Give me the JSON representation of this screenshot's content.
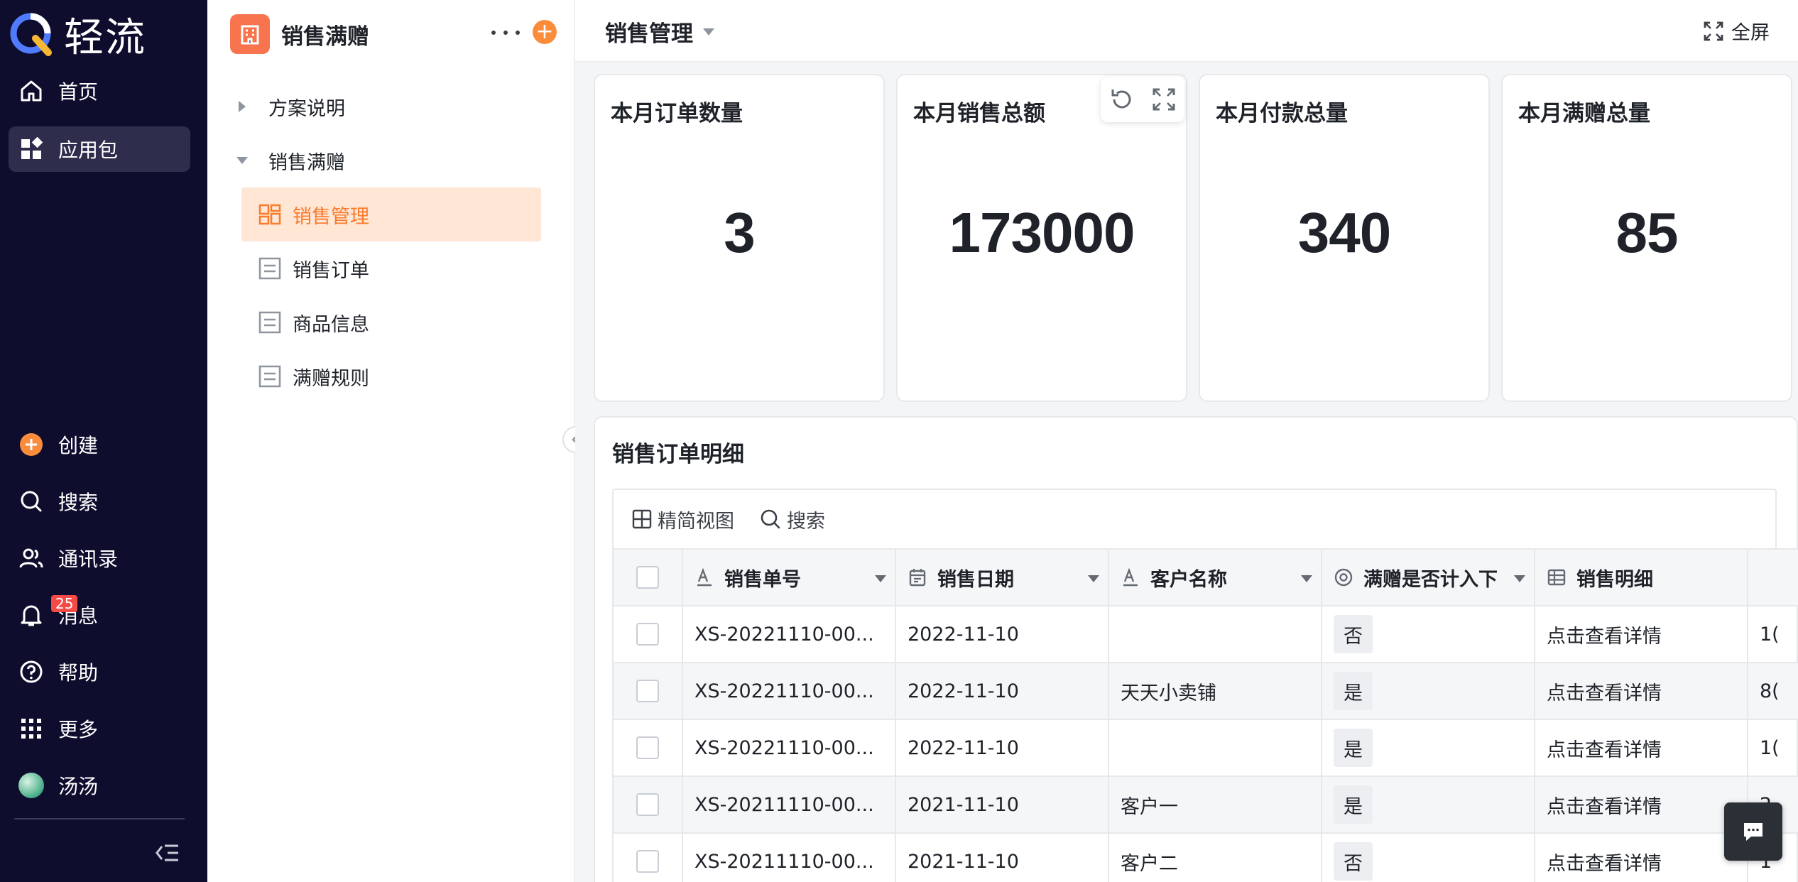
{
  "brand": {
    "name": "轻流"
  },
  "nav": {
    "top": [
      {
        "label": "首页",
        "icon": "home-icon"
      },
      {
        "label": "应用包",
        "icon": "apps-icon",
        "active": true
      }
    ],
    "bottom": [
      {
        "label": "创建",
        "icon": "plus-circle-icon"
      },
      {
        "label": "搜索",
        "icon": "search-icon"
      },
      {
        "label": "通讯录",
        "icon": "contacts-icon"
      },
      {
        "label": "消息",
        "icon": "bell-icon",
        "badge": "25"
      },
      {
        "label": "帮助",
        "icon": "help-icon"
      },
      {
        "label": "更多",
        "icon": "grid-icon"
      },
      {
        "label": "汤汤",
        "icon": "avatar"
      }
    ]
  },
  "sidebar": {
    "app_title": "销售满赠",
    "groups": [
      {
        "label": "方案说明",
        "expanded": false
      },
      {
        "label": "销售满赠",
        "expanded": true
      }
    ],
    "items": [
      {
        "label": "销售管理",
        "icon": "dashboard-icon",
        "active": true
      },
      {
        "label": "销售订单",
        "icon": "form-icon"
      },
      {
        "label": "商品信息",
        "icon": "form-icon"
      },
      {
        "label": "满赠规则",
        "icon": "form-icon"
      }
    ]
  },
  "header": {
    "title": "销售管理",
    "fullscreen_label": "全屏"
  },
  "stats": [
    {
      "title": "本月订单数量",
      "value": "3"
    },
    {
      "title": "本月销售总额",
      "value": "173000"
    },
    {
      "title": "本月付款总量",
      "value": "340"
    },
    {
      "title": "本月满赠总量",
      "value": "85"
    }
  ],
  "detail": {
    "title": "销售订单明细",
    "toolbar": {
      "view_label": "精简视图",
      "search_label": "搜索"
    },
    "columns": [
      {
        "label": "销售单号",
        "icon": "text-field-icon"
      },
      {
        "label": "销售日期",
        "icon": "calendar-icon"
      },
      {
        "label": "客户名称",
        "icon": "text-field-icon"
      },
      {
        "label": "满赠是否计入下",
        "icon": "radio-icon"
      },
      {
        "label": "销售明细",
        "icon": "subtable-icon"
      }
    ],
    "rows": [
      {
        "no": "XS-20221110-00...",
        "date": "2022-11-10",
        "customer": "",
        "included": "否",
        "detail": "点击查看详情",
        "extra": "1("
      },
      {
        "no": "XS-20221110-00...",
        "date": "2022-11-10",
        "customer": "天天小卖铺",
        "included": "是",
        "detail": "点击查看详情",
        "extra": "8("
      },
      {
        "no": "XS-20221110-00...",
        "date": "2022-11-10",
        "customer": "",
        "included": "是",
        "detail": "点击查看详情",
        "extra": "1("
      },
      {
        "no": "XS-20211110-00...",
        "date": "2021-11-10",
        "customer": "客户一",
        "included": "是",
        "detail": "点击查看详情",
        "extra": "2"
      },
      {
        "no": "XS-20211110-00...",
        "date": "2021-11-10",
        "customer": "客户二",
        "included": "否",
        "detail": "点击查看详情",
        "extra": "1"
      }
    ]
  },
  "colors": {
    "rail_bg": "#0e0d2e",
    "accent": "#fb7b2c",
    "active_bg": "#ffe6d5",
    "app_icon": "#f7744e"
  }
}
